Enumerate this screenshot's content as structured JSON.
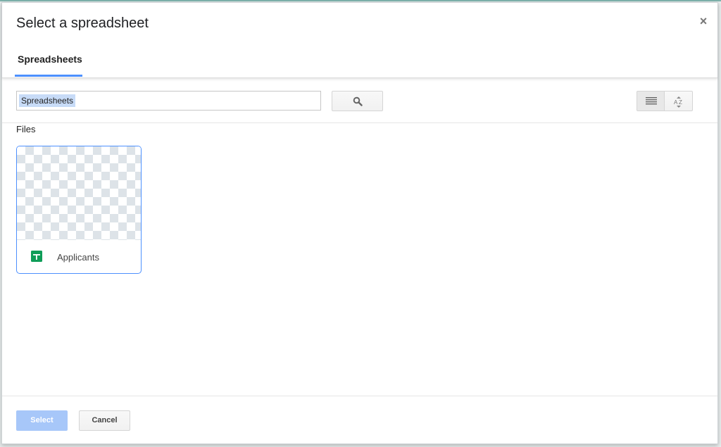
{
  "dialog": {
    "title": "Select a spreadsheet",
    "close_glyph": "×"
  },
  "tabs": [
    {
      "label": "Spreadsheets",
      "active": true
    }
  ],
  "search": {
    "value": "Spreadsheets",
    "button_icon": "search-icon"
  },
  "view_controls": {
    "list_icon": "list-view-icon",
    "sort_icon": "sort-az-icon"
  },
  "files": {
    "section_label": "Files",
    "items": [
      {
        "name": "Applicants",
        "icon": "google-sheets-icon"
      }
    ]
  },
  "footer": {
    "select_label": "Select",
    "cancel_label": "Cancel"
  },
  "colors": {
    "accent": "#4d90fe",
    "select_button_disabled": "#a7c7f9",
    "sheets_green": "#0f9d58"
  }
}
